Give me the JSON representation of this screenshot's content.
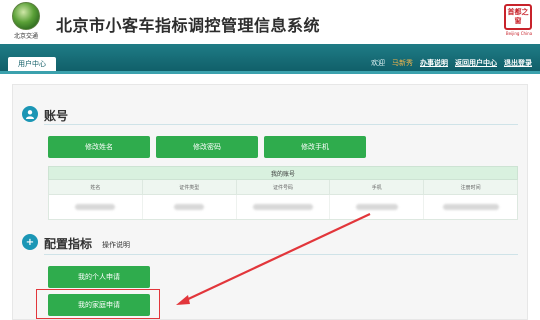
{
  "header": {
    "logo_text": "北京交通",
    "title": "北京市小客车指标调控管理信息系统",
    "seal_text": "首都之窗",
    "seal_sub": "Beijing China"
  },
  "nav": {
    "user_center": "用户中心",
    "welcome": "欢迎",
    "username": "马新秀",
    "links": [
      "办事说明",
      "返回用户中心",
      "退出登录"
    ]
  },
  "account": {
    "title": "账号",
    "buttons": [
      "修改姓名",
      "修改密码",
      "修改手机"
    ],
    "table_caption": "我的账号",
    "columns": [
      "姓名",
      "证件类型",
      "证件号码",
      "手机",
      "注册时间"
    ]
  },
  "config": {
    "title": "配置指标",
    "guide_link": "操作说明",
    "buttons": [
      "我的个人申请",
      "我的家庭申请"
    ]
  },
  "colors": {
    "nav_bg": "#0f5c66",
    "button_green": "#2fac4d",
    "icon_blue": "#1b96b5",
    "annotation_red": "#e2363b"
  }
}
